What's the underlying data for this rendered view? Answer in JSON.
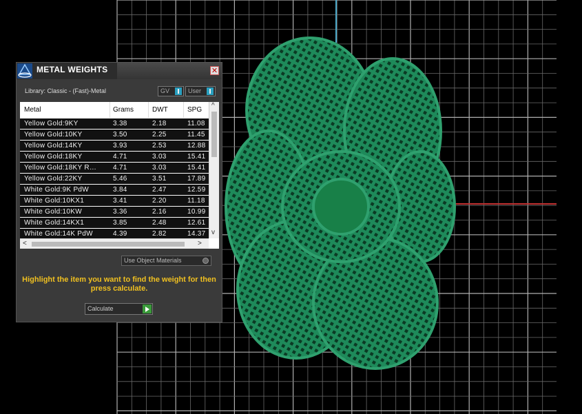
{
  "panel": {
    "title": "METAL WEIGHTS",
    "close": "✕",
    "library_label": "Library: Classic - (Fast)-Metal",
    "toggles": [
      {
        "label": "GV"
      },
      {
        "label": "User"
      }
    ],
    "columns": [
      "Metal",
      "Grams",
      "DWT",
      "SPG"
    ],
    "rows": [
      {
        "metal": "Yellow Gold:9KY",
        "grams": "3.38",
        "dwt": "2.18",
        "spg": "11.08"
      },
      {
        "metal": "Yellow Gold:10KY",
        "grams": "3.50",
        "dwt": "2.25",
        "spg": "11.45"
      },
      {
        "metal": "Yellow Gold:14KY",
        "grams": "3.93",
        "dwt": "2.53",
        "spg": "12.88"
      },
      {
        "metal": "Yellow Gold:18KY",
        "grams": "4.71",
        "dwt": "3.03",
        "spg": "15.41"
      },
      {
        "metal": "Yellow Gold:18KY R…",
        "grams": "4.71",
        "dwt": "3.03",
        "spg": "15.41"
      },
      {
        "metal": "Yellow Gold:22KY",
        "grams": "5.46",
        "dwt": "3.51",
        "spg": "17.89"
      },
      {
        "metal": "White Gold:9K PdW",
        "grams": "3.84",
        "dwt": "2.47",
        "spg": "12.59"
      },
      {
        "metal": "White Gold:10KX1",
        "grams": "3.41",
        "dwt": "2.20",
        "spg": "11.18"
      },
      {
        "metal": "White Gold:10KW",
        "grams": "3.36",
        "dwt": "2.16",
        "spg": "10.99"
      },
      {
        "metal": "White Gold:14KX1",
        "grams": "3.85",
        "dwt": "2.48",
        "spg": "12.61"
      },
      {
        "metal": "White Gold:14K PdW",
        "grams": "4.39",
        "dwt": "2.82",
        "spg": "14.37"
      }
    ],
    "scroll_left": "<",
    "scroll_right": ">",
    "scroll_up": "^",
    "scroll_down": "v",
    "use_object_materials": "Use Object Materials",
    "hint": "Highlight the item you want to find the weight for then press calculate.",
    "calculate": "Calculate"
  },
  "colors": {
    "model_green": "#1e8a5a",
    "axis_blue": "#4aa8c8",
    "axis_red": "#c03030",
    "grid": "#9a9a9a",
    "hint_yellow": "#f0c020"
  }
}
